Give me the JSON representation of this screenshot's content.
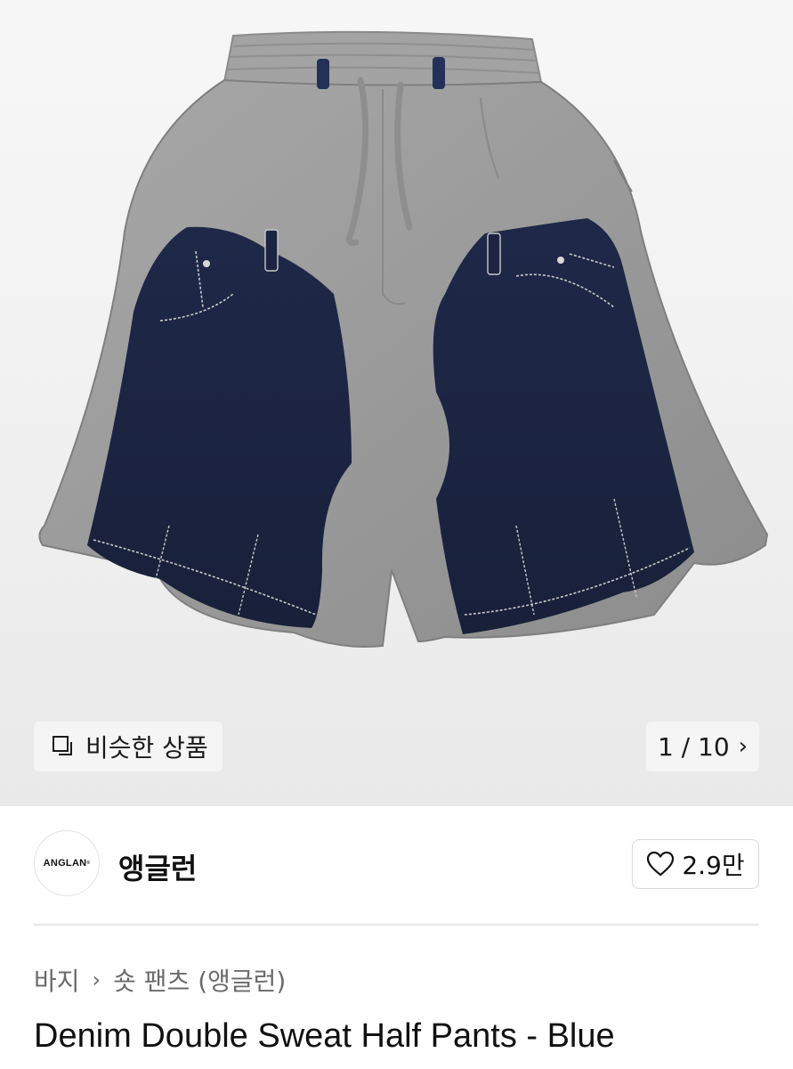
{
  "gallery": {
    "similar_label": "비슷한 상품",
    "similar_icon": "similar-items-icon",
    "counter": "1 / 10",
    "next_icon": "chevron-right-icon",
    "colors": {
      "sweat": "#9c9c9c",
      "denim": "#1d2540",
      "stitch": "#c9c9c9"
    }
  },
  "brand": {
    "logo_text": "ANGLAN",
    "name": "앵글런",
    "like_count": "2.9만",
    "like_icon": "heart-icon"
  },
  "breadcrumb": {
    "items": [
      "바지",
      "숏 팬츠 (앵글런)"
    ],
    "separator_icon": "chevron-right-icon"
  },
  "product": {
    "title": "Denim Double Sweat Half Pants - Blue"
  }
}
